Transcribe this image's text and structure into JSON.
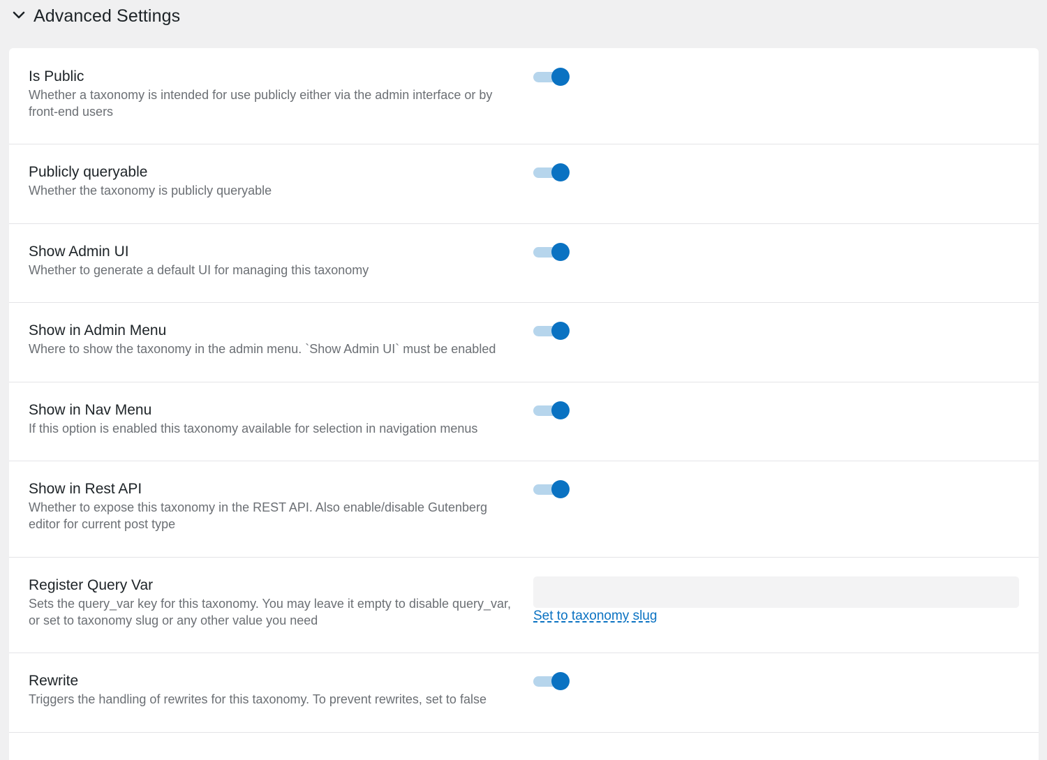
{
  "section": {
    "title": "Advanced Settings",
    "expanded": true
  },
  "colors": {
    "background": "#f0f0f1",
    "panel": "#ffffff",
    "toggle_on": "#0a72c2",
    "toggle_track": "#b6d5ec",
    "link": "#0a72c2"
  },
  "settings": [
    {
      "label": "Is Public",
      "description": "Whether a taxonomy is intended for use publicly either via the admin interface or by front-end users",
      "control": "toggle",
      "enabled": true
    },
    {
      "label": "Publicly queryable",
      "description": "Whether the taxonomy is publicly queryable",
      "control": "toggle",
      "enabled": true
    },
    {
      "label": "Show Admin UI",
      "description": "Whether to generate a default UI for managing this taxonomy",
      "control": "toggle",
      "enabled": true
    },
    {
      "label": "Show in Admin Menu",
      "description": "Where to show the taxonomy in the admin menu. `Show Admin UI` must be enabled",
      "control": "toggle",
      "enabled": true
    },
    {
      "label": "Show in Nav Menu",
      "description": "If this option is enabled this taxonomy available for selection in navigation menus",
      "control": "toggle",
      "enabled": true
    },
    {
      "label": "Show in Rest API",
      "description": "Whether to expose this taxonomy in the REST API. Also enable/disable Gutenberg editor for current post type",
      "control": "toggle",
      "enabled": true
    },
    {
      "label": "Register Query Var",
      "description": "Sets the query_var key for this taxonomy. You may leave it empty to disable query_var, or set to taxonomy slug or any other value you need",
      "control": "text",
      "value": "",
      "placeholder": "",
      "link_label": "Set to taxonomy slug"
    },
    {
      "label": "Rewrite",
      "description": "Triggers the handling of rewrites for this taxonomy. To prevent rewrites, set to false",
      "control": "toggle",
      "enabled": true
    }
  ]
}
